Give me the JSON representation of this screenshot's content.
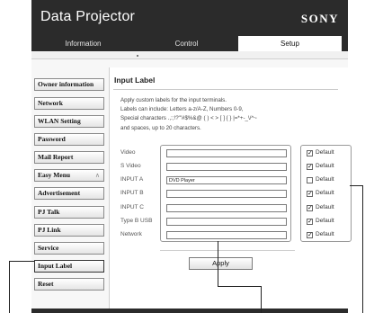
{
  "header": {
    "title": "Data Projector",
    "brand": "SONY"
  },
  "tabs": [
    {
      "label": "Information",
      "active": false
    },
    {
      "label": "Control",
      "active": false
    },
    {
      "label": "Setup",
      "active": true
    }
  ],
  "sidebar": {
    "items": [
      {
        "label": "Owner information"
      },
      {
        "label": "Network"
      },
      {
        "label": "WLAN Setting"
      },
      {
        "label": "Password"
      },
      {
        "label": "Mail Report"
      },
      {
        "label": "Easy Menu"
      },
      {
        "label": "Advertisement"
      },
      {
        "label": "PJ Talk"
      },
      {
        "label": "PJ Link"
      },
      {
        "label": "Service"
      },
      {
        "label": "Input Label",
        "selected": true
      },
      {
        "label": "Reset"
      }
    ]
  },
  "main": {
    "title": "Input Label",
    "description": [
      "Apply custom labels for the input terminals.",
      "Labels can include: Letters a-z/A-Z, Numbers 0-9,",
      "Special characters .,:;!?\"'#$%&@ ( ) < > [ ] { } |=*+-_\\/^~",
      "and spaces, up to 20 characters."
    ],
    "rows": [
      {
        "label": "Video",
        "value": "",
        "default_label": "Default",
        "default_checked": true
      },
      {
        "label": "S Video",
        "value": "",
        "default_label": "Default",
        "default_checked": true
      },
      {
        "label": "INPUT A",
        "value": "DVD Player",
        "default_label": "Default",
        "default_checked": false
      },
      {
        "label": "INPUT B",
        "value": "",
        "default_label": "Default",
        "default_checked": true
      },
      {
        "label": "INPUT C",
        "value": "",
        "default_label": "Default",
        "default_checked": true
      },
      {
        "label": "Type B USB",
        "value": "",
        "default_label": "Default",
        "default_checked": true
      },
      {
        "label": "Network",
        "value": "",
        "default_label": "Default",
        "default_checked": true
      }
    ],
    "apply_label": "Apply"
  },
  "icons": {
    "expand": "chevron-double-up-icon",
    "checkmark": "check-icon"
  },
  "colors": {
    "header_bg": "#2b2b2b",
    "page_bg": "#f7f7f7"
  }
}
